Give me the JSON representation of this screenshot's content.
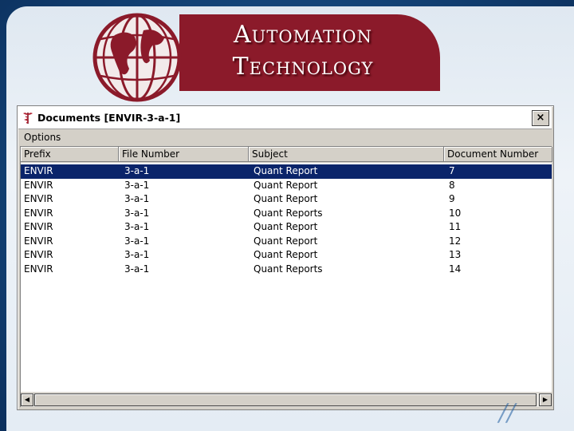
{
  "slide": {
    "title_line1": "Automation",
    "title_line2": "Technology",
    "banner_color": "#8b1a2a"
  },
  "window": {
    "title": "Documents [ENVIR-3-a-1]",
    "icon": "caduceus-icon",
    "close_label": "×"
  },
  "menu": {
    "items": [
      {
        "label": "Options"
      }
    ]
  },
  "list": {
    "columns": [
      "Prefix",
      "File Number",
      "Subject",
      "Document Number"
    ],
    "rows": [
      [
        "ENVIR",
        "3-a-1",
        "Quant Report",
        "7"
      ],
      [
        "ENVIR",
        "3-a-1",
        "Quant Report",
        "8"
      ],
      [
        "ENVIR",
        "3-a-1",
        "Quant Report",
        "9"
      ],
      [
        "ENVIR",
        "3-a-1",
        "Quant Reports",
        "10"
      ],
      [
        "ENVIR",
        "3-a-1",
        "Quant Report",
        "11"
      ],
      [
        "ENVIR",
        "3-a-1",
        "Quant Report",
        "12"
      ],
      [
        "ENVIR",
        "3-a-1",
        "Quant Report",
        "13"
      ],
      [
        "ENVIR",
        "3-a-1",
        "Quant Reports",
        "14"
      ]
    ],
    "selected_row": 0,
    "selection_color": "#0a246a"
  },
  "scrollbar": {
    "left_arrow": "◀",
    "right_arrow": "▶"
  }
}
